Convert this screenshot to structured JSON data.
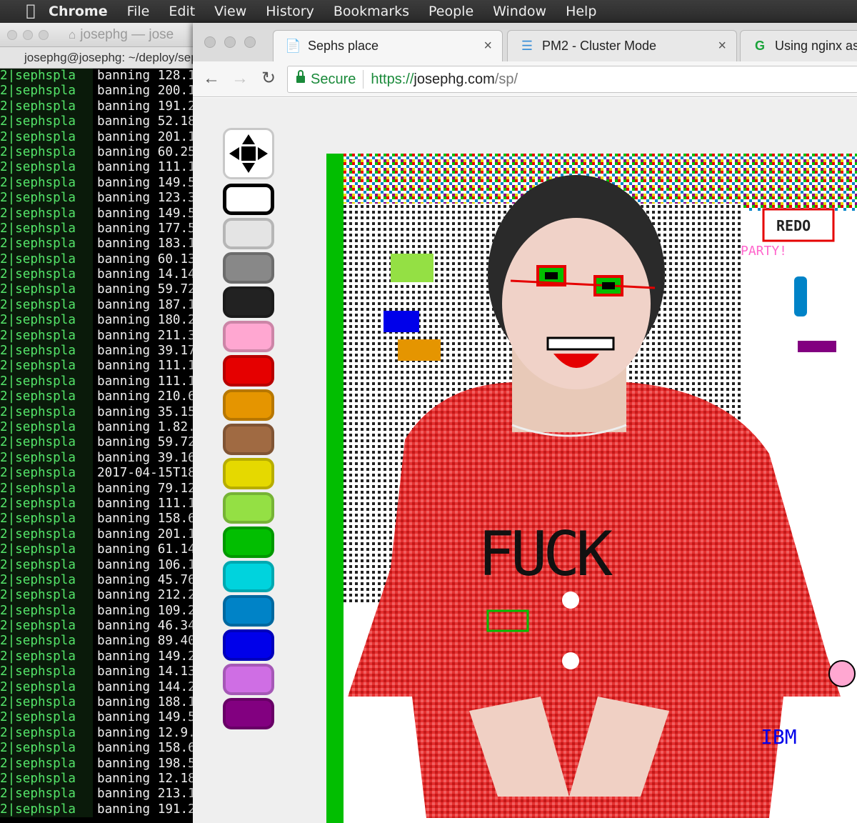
{
  "menubar": {
    "items": [
      "Chrome",
      "File",
      "Edit",
      "View",
      "History",
      "Bookmarks",
      "People",
      "Window",
      "Help"
    ]
  },
  "terminal": {
    "title": "josephg — jose",
    "tab_title": "josephg@josephg: ~/deploy/sep",
    "prefix": "2|sephspla",
    "lines": [
      "banning 128.1",
      "banning 200.1",
      "banning 191.2",
      "banning 52.18",
      "banning 201.1",
      "banning 60.25",
      "banning 111.1",
      "banning 149.5",
      "banning 123.3",
      "banning 149.5",
      "banning 177.5",
      "banning 183.1",
      "banning 60.13",
      "banning 14.14",
      "banning 59.72",
      "banning 187.1",
      "banning 180.2",
      "banning 211.3",
      "banning 39.17",
      "banning 111.1",
      "banning 111.1",
      "banning 210.6",
      "banning 35.15",
      "banning 1.82.",
      "banning 59.72",
      "banning 39.16",
      "2017-04-15T18",
      "banning 79.12",
      "banning 111.1",
      "banning 158.6",
      "banning 201.1",
      "banning 61.14",
      "banning 106.1",
      "banning 45.76",
      "banning 212.2",
      "banning 109.2",
      "banning 46.34",
      "banning 89.40",
      "banning 149.2",
      "banning 14.13",
      "banning 144.2",
      "banning 188.1",
      "banning 149.5",
      "banning 12.9.",
      "banning 158.6",
      "banning 198.5",
      "banning 12.18",
      "banning 213.1",
      "banning 191.2"
    ]
  },
  "browser": {
    "tabs": [
      {
        "title": "Sephs place",
        "icon": "document-icon"
      },
      {
        "title": "PM2 - Cluster Mode",
        "icon": "menu-icon"
      },
      {
        "title": "Using nginx as",
        "icon": "g-icon"
      }
    ],
    "address": {
      "secure_label": "Secure",
      "scheme": "https://",
      "host": "josephg.com",
      "path": "/sp/"
    }
  },
  "palette": {
    "selected_index": 0,
    "colors": [
      "#ffffff",
      "#e4e4e4",
      "#888888",
      "#222222",
      "#ffa7d1",
      "#e50000",
      "#e59500",
      "#a06a42",
      "#e5d900",
      "#94e044",
      "#02be01",
      "#00d3dd",
      "#0083c7",
      "#0000ea",
      "#cf6ee4",
      "#820080"
    ]
  },
  "canvas_text": {
    "redo": "REDO",
    "party": "PARTY!",
    "ibm": "IBM",
    "shirt": "FUCK"
  },
  "accent_colors": {
    "secure_green": "#1a8a3a",
    "terminal_green": "#55e66a"
  }
}
